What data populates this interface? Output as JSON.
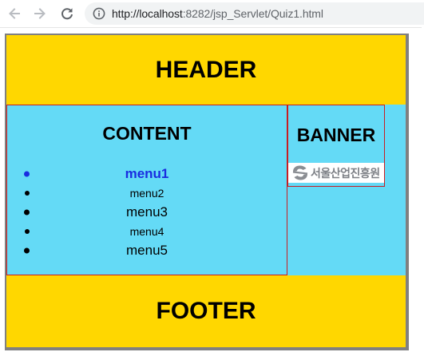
{
  "browser": {
    "url_host": "http://localhost",
    "url_path": ":8282/jsp_Servlet/Quiz1.html",
    "back_icon": "arrow-left-icon",
    "forward_icon": "arrow-right-icon",
    "reload_icon": "reload-icon",
    "info_icon": "info-circle-icon"
  },
  "page": {
    "header": "HEADER",
    "content_title": "CONTENT",
    "menu": [
      {
        "label": "menu1",
        "active": true,
        "size": "big"
      },
      {
        "label": "menu2",
        "active": false,
        "size": "small"
      },
      {
        "label": "menu3",
        "active": false,
        "size": "big"
      },
      {
        "label": "menu4",
        "active": false,
        "size": "small"
      },
      {
        "label": "menu5",
        "active": false,
        "size": "big"
      }
    ],
    "banner_title": "BANNER",
    "banner_logo_text": "서울산업진흥원",
    "footer": "FOOTER"
  },
  "colors": {
    "header_footer": "#ffd700",
    "content_bg": "#64daf6",
    "border_red": "#c81d22",
    "active_menu": "#1a2ce0",
    "page_border": "#808080"
  }
}
